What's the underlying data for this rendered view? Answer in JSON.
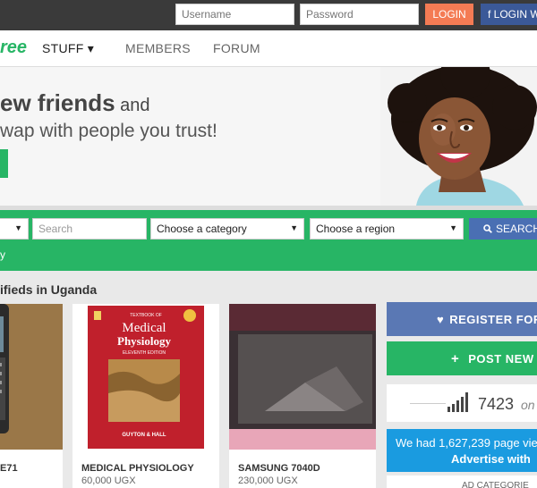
{
  "topbar": {
    "username_placeholder": "Username",
    "password_placeholder": "Password",
    "login_label": "LOGIN",
    "facebook_label": "f LOGIN W"
  },
  "nav": {
    "logo_text": "ree",
    "items": [
      {
        "label": "STUFF ▾"
      },
      {
        "label": "MEMBERS"
      },
      {
        "label": "FORUM"
      }
    ]
  },
  "hero": {
    "headline_bold": "ew friends",
    "headline_and": " and",
    "subline": "wap with people you trust!"
  },
  "search": {
    "keyword_placeholder": "Search",
    "category_label": "Choose a category",
    "region_label": "Choose a region",
    "button_label": "SEARCH",
    "below_text": "y"
  },
  "listings": {
    "section_title": "ifieds in Uganda",
    "items": [
      {
        "title": "E71",
        "price": ""
      },
      {
        "title": "MEDICAL PHYSIOLOGY",
        "price": "60,000 UGX"
      },
      {
        "title": "SAMSUNG 7040D",
        "price": "230,000 UGX"
      }
    ]
  },
  "book_cover": {
    "top_text": "TEXTBOOK OF",
    "title1": "Medical",
    "title2": "Physiology",
    "edition": "ELEVENTH EDITION",
    "authors": "GUYTON & HALL"
  },
  "sidebar": {
    "register_label": "REGISTER FOR",
    "post_label": "POST NEW",
    "stats_number": "7423",
    "stats_suffix": "on",
    "info_line1": "We had 1,627,239 page vie",
    "info_line2": "Advertise with",
    "ad_categories": "AD CATEGORIE"
  },
  "colors": {
    "brand_green": "#27b565",
    "login_orange": "#f47b54",
    "facebook_blue": "#3b5998",
    "search_blue": "#4a6fb3",
    "info_blue": "#1a9be0"
  }
}
